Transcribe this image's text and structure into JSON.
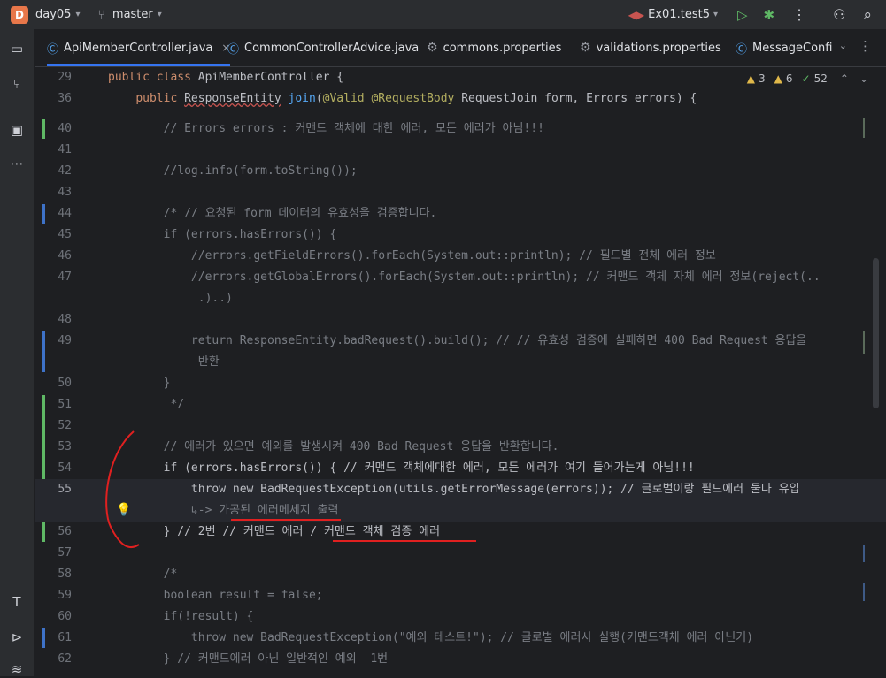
{
  "topbar": {
    "project_initial": "D",
    "project_name": "day05",
    "branch": "master",
    "run_config": "Ex01.test5"
  },
  "tabs": [
    {
      "label": "ApiMemberController.java",
      "active": true
    },
    {
      "label": "CommonControllerAdvice.java"
    },
    {
      "label": "commons.properties"
    },
    {
      "label": "validations.properties"
    },
    {
      "label": "MessageConfi"
    }
  ],
  "inspections": {
    "warnings": "3",
    "weak": "6",
    "ok": "52"
  },
  "sticky": [
    {
      "num": "29",
      "code": "public class ApiMemberController {"
    },
    {
      "num": "36",
      "code": "    public ResponseEntity join(@Valid @RequestBody RequestJoin form, Errors errors) {"
    }
  ],
  "lines": [
    {
      "num": "40",
      "text": "        // Errors errors : 커맨드 객체에 대한 에러, 모든 에러가 아님!!!"
    },
    {
      "num": "41",
      "text": ""
    },
    {
      "num": "42",
      "text": "        //log.info(form.toString());"
    },
    {
      "num": "43",
      "text": ""
    },
    {
      "num": "44",
      "text": "        /* // 요청된 form 데이터의 유효성을 검증합니다."
    },
    {
      "num": "45",
      "text": "        if (errors.hasErrors()) {"
    },
    {
      "num": "46",
      "text": "            //errors.getFieldErrors().forEach(System.out::println); // 필드별 전체 에러 정보"
    },
    {
      "num": "47",
      "text": "            //errors.getGlobalErrors().forEach(System.out::println); // 커맨드 객체 자체 에러 정보(reject(.."
    },
    {
      "num": "",
      "text": "             .)..)"
    },
    {
      "num": "48",
      "text": ""
    },
    {
      "num": "49",
      "text": "            return ResponseEntity.badRequest().build(); // // 유효성 검증에 실패하면 400 Bad Request 응답을"
    },
    {
      "num": "",
      "text": "             반환"
    },
    {
      "num": "50",
      "text": "        }"
    },
    {
      "num": "51",
      "text": "         */"
    },
    {
      "num": "52",
      "text": ""
    },
    {
      "num": "53",
      "text": "        // 에러가 있으면 예외를 발생시켜 400 Bad Request 응답을 반환합니다."
    },
    {
      "num": "54",
      "text": "        if (errors.hasErrors()) { // 커맨드 객체에대한 에러, 모든 에러가 여기 들어가는게 아님!!!"
    },
    {
      "num": "55",
      "text": "            throw new BadRequestException(utils.getErrorMessage(errors)); // 글로벌이랑 필드에러 둘다 유입"
    },
    {
      "num": "",
      "text": "            ↳-> 가공된 에러메세지 출력"
    },
    {
      "num": "56",
      "text": "        } // 2번 // 커맨드 에러 / 커맨드 객체 검증 에러"
    },
    {
      "num": "57",
      "text": ""
    },
    {
      "num": "58",
      "text": "        /*"
    },
    {
      "num": "59",
      "text": "        boolean result = false;"
    },
    {
      "num": "60",
      "text": "        if(!result) {"
    },
    {
      "num": "61",
      "text": "            throw new BadRequestException(\"예외 테스트!\"); // 글로벌 에러시 실행(커맨드객체 에러 아닌거)"
    },
    {
      "num": "62",
      "text": "        } // 커맨드에러 아닌 일반적인 예외  1번"
    }
  ]
}
